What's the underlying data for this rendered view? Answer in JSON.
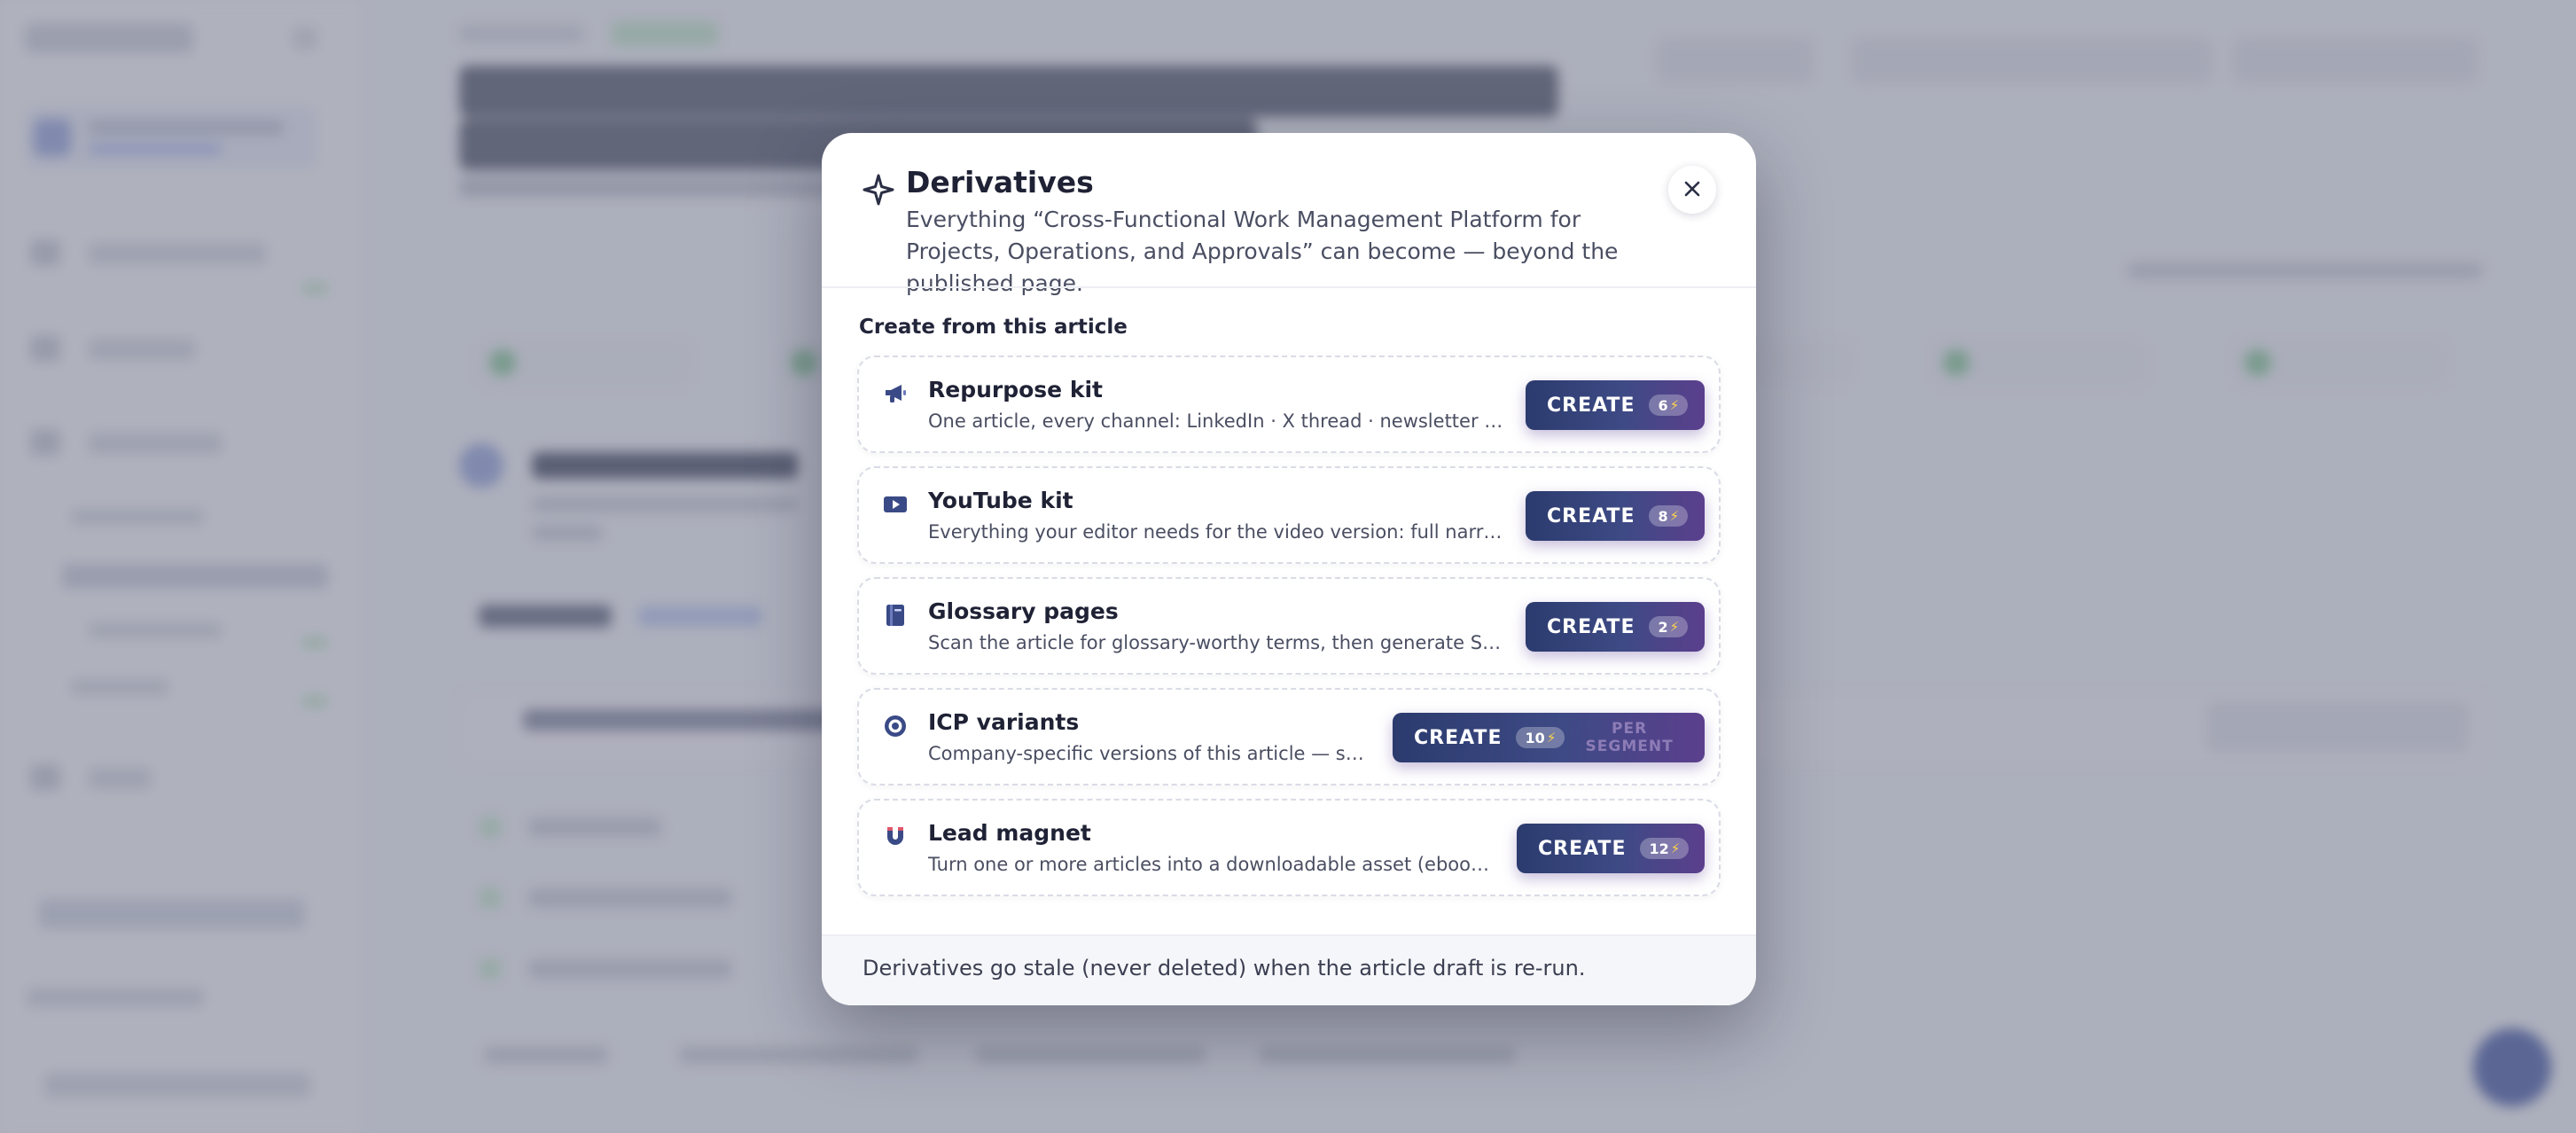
{
  "modal": {
    "title": "Derivatives",
    "description": "Everything “Cross-Functional Work Management Platform for Projects, Operations, and Approvals” can become — beyond the published page.",
    "section_heading": "Create from this article",
    "footer_note": "Derivatives go stale (never deleted) when the article draft is re-run.",
    "bolt_glyph": "⚡",
    "items": [
      {
        "title": "Repurpose kit",
        "description": "One article, every channel: LinkedIn · X thread · newsletter · Instagr…",
        "icon": "megaphone-icon",
        "button_label": "CREATE",
        "cost": "6"
      },
      {
        "title": "YouTube kit",
        "description": "Everything your editor needs for the video version: full narration sc…",
        "icon": "youtube-play-icon",
        "button_label": "CREATE",
        "cost": "8"
      },
      {
        "title": "Glossary pages",
        "description": "Scan the article for glossary-worthy terms, then generate SEO defi…",
        "icon": "book-icon",
        "button_label": "CREATE",
        "cost": "2"
      },
      {
        "title": "ICP variants",
        "description": "Company-specific versions of this article — same c…",
        "icon": "target-icon",
        "button_label": "CREATE",
        "cost": "10",
        "unit": "PER SEGMENT"
      },
      {
        "title": "Lead magnet",
        "description": "Turn one or more articles into a downloadable asset (ebook · guide…",
        "icon": "magnet-icon",
        "button_label": "CREATE",
        "cost": "12"
      }
    ]
  },
  "colors": {
    "primary_button_start": "#2b3b6e",
    "primary_button_end": "#5b3f8d",
    "bolt": "#ffd54a",
    "overlay": "#767a8c"
  }
}
